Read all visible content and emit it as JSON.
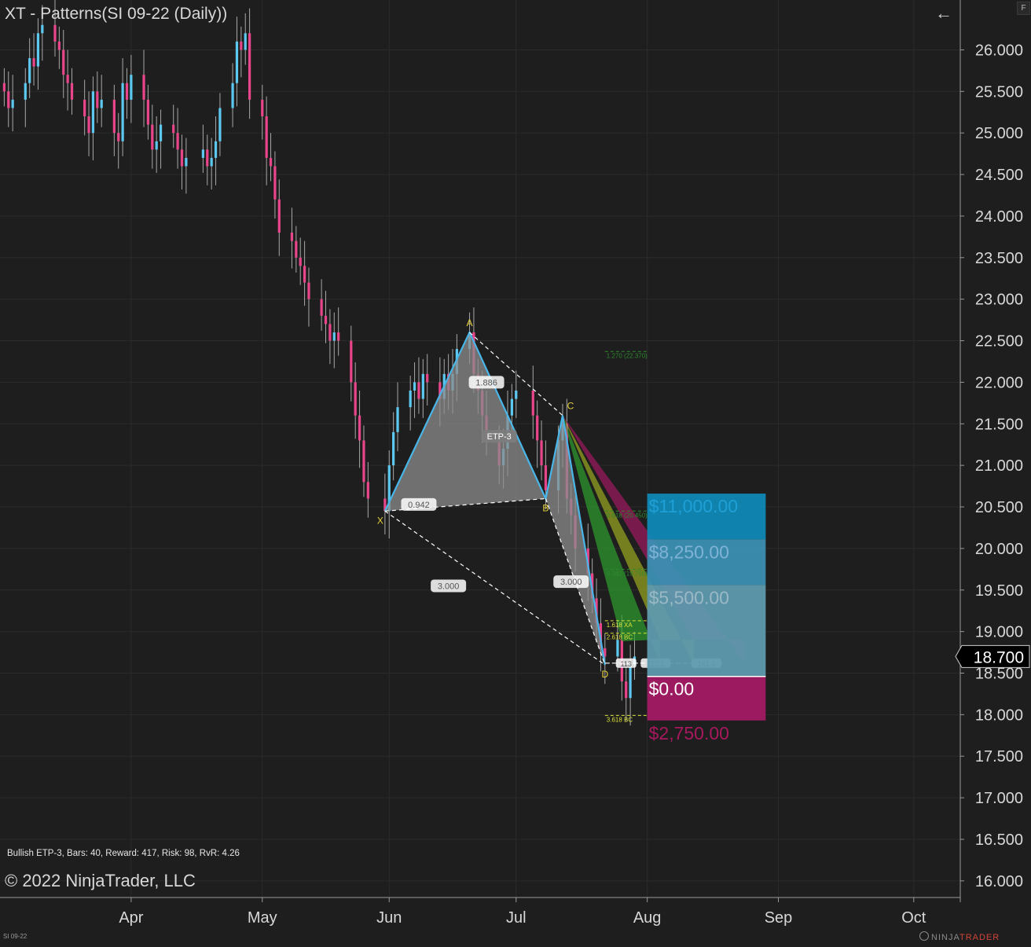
{
  "window": {
    "title": "XT - Patterns(SI 09-22 (Daily))",
    "f_badge": "F",
    "instrument_small": "SI 09-22",
    "copyright": "© 2022 NinjaTrader, LLC",
    "brand_main": "NINJA",
    "brand_accent": "TRADER",
    "status_line": "Bullish ETP-3, Bars: 40, Reward: 417, Risk: 98, RvR: 4.26"
  },
  "colors": {
    "background": "#1e1e1e",
    "up_candle": "#5cc8f0",
    "down_candle": "#e8458a",
    "pattern_line": "#49b6ea",
    "pattern_fill": "#8c8c8c",
    "target_blue": "#0f89b6",
    "stop_magenta": "#9c1a5f",
    "label_yellow": "#e9d33a",
    "fib_green": "#2e8a2e"
  },
  "chart_data": {
    "type": "candlestick",
    "instrument": "SI 09-22",
    "timeframe": "Daily",
    "y_axis": {
      "ticks": [
        16.0,
        16.5,
        17.0,
        17.5,
        18.0,
        18.5,
        19.0,
        19.5,
        20.0,
        20.5,
        21.0,
        21.5,
        22.0,
        22.5,
        23.0,
        23.5,
        24.0,
        24.5,
        25.0,
        25.5,
        26.0
      ],
      "tick_labels": [
        "16.000",
        "16.500",
        "17.000",
        "17.500",
        "18.000",
        "18.500",
        "19.000",
        "19.500",
        "20.000",
        "20.500",
        "21.000",
        "21.500",
        "22.000",
        "22.500",
        "23.000",
        "23.500",
        "24.000",
        "24.500",
        "25.000",
        "25.500",
        "26.000"
      ],
      "range": [
        15.8,
        26.6
      ]
    },
    "x_axis": {
      "tick_labels": [
        "Apr",
        "May",
        "Jun",
        "Jul",
        "Aug",
        "Sep",
        "Oct"
      ],
      "tick_dates": [
        "2022-04-01",
        "2022-05-02",
        "2022-06-01",
        "2022-07-01",
        "2022-08-01",
        "2022-09-01",
        "2022-10-03"
      ],
      "range": [
        "2022-03-01",
        "2022-10-14"
      ]
    },
    "grid": true,
    "last_price": 18.7,
    "last_price_label": "18.700",
    "closes": [
      [
        "2022-03-02",
        25.5
      ],
      [
        "2022-03-03",
        25.3
      ],
      [
        "2022-03-04",
        25.4
      ],
      [
        "2022-03-07",
        25.6
      ],
      [
        "2022-03-08",
        25.9
      ],
      [
        "2022-03-09",
        25.8
      ],
      [
        "2022-03-10",
        26.2
      ],
      [
        "2022-03-11",
        26.3
      ],
      [
        "2022-03-14",
        26.1
      ],
      [
        "2022-03-15",
        26.0
      ],
      [
        "2022-03-16",
        25.7
      ],
      [
        "2022-03-17",
        25.6
      ],
      [
        "2022-03-18",
        25.4
      ],
      [
        "2022-03-21",
        25.2
      ],
      [
        "2022-03-22",
        25.0
      ],
      [
        "2022-03-23",
        25.5
      ],
      [
        "2022-03-24",
        25.3
      ],
      [
        "2022-03-25",
        25.4
      ],
      [
        "2022-03-28",
        25.0
      ],
      [
        "2022-03-29",
        24.9
      ],
      [
        "2022-03-30",
        25.6
      ],
      [
        "2022-03-31",
        25.4
      ],
      [
        "2022-04-01",
        25.7
      ],
      [
        "2022-04-04",
        25.4
      ],
      [
        "2022-04-05",
        25.1
      ],
      [
        "2022-04-06",
        24.8
      ],
      [
        "2022-04-07",
        24.9
      ],
      [
        "2022-04-08",
        25.1
      ],
      [
        "2022-04-11",
        25.0
      ],
      [
        "2022-04-12",
        24.8
      ],
      [
        "2022-04-13",
        24.6
      ],
      [
        "2022-04-14",
        24.7
      ],
      [
        "2022-04-18",
        24.8
      ],
      [
        "2022-04-19",
        24.6
      ],
      [
        "2022-04-20",
        24.7
      ],
      [
        "2022-04-21",
        24.9
      ],
      [
        "2022-04-22",
        25.3
      ],
      [
        "2022-04-25",
        25.6
      ],
      [
        "2022-04-26",
        26.1
      ],
      [
        "2022-04-27",
        26.0
      ],
      [
        "2022-04-28",
        26.2
      ],
      [
        "2022-04-29",
        25.4
      ],
      [
        "2022-05-02",
        25.2
      ],
      [
        "2022-05-03",
        24.7
      ],
      [
        "2022-05-04",
        24.6
      ],
      [
        "2022-05-05",
        24.2
      ],
      [
        "2022-05-06",
        23.8
      ],
      [
        "2022-05-09",
        23.7
      ],
      [
        "2022-05-10",
        23.5
      ],
      [
        "2022-05-11",
        23.4
      ],
      [
        "2022-05-12",
        23.2
      ],
      [
        "2022-05-13",
        23.0
      ],
      [
        "2022-05-16",
        22.8
      ],
      [
        "2022-05-17",
        22.7
      ],
      [
        "2022-05-18",
        22.5
      ],
      [
        "2022-05-19",
        22.6
      ],
      [
        "2022-05-20",
        22.5
      ],
      [
        "2022-05-23",
        22.0
      ],
      [
        "2022-05-24",
        21.6
      ],
      [
        "2022-05-25",
        21.3
      ],
      [
        "2022-05-26",
        20.8
      ],
      [
        "2022-05-27",
        20.6
      ],
      [
        "2022-05-31",
        20.45
      ],
      [
        "2022-06-01",
        21.0
      ],
      [
        "2022-06-02",
        21.4
      ],
      [
        "2022-06-03",
        21.7
      ],
      [
        "2022-06-06",
        21.9
      ],
      [
        "2022-06-07",
        22.0
      ],
      [
        "2022-06-08",
        21.8
      ],
      [
        "2022-06-09",
        22.1
      ],
      [
        "2022-06-10",
        22.0
      ],
      [
        "2022-06-13",
        21.8
      ],
      [
        "2022-06-14",
        22.1
      ],
      [
        "2022-06-15",
        21.9
      ],
      [
        "2022-06-16",
        22.1
      ],
      [
        "2022-06-17",
        22.4
      ],
      [
        "2022-06-20",
        22.6
      ],
      [
        "2022-06-21",
        22.1
      ],
      [
        "2022-06-22",
        21.9
      ],
      [
        "2022-06-23",
        21.6
      ],
      [
        "2022-06-24",
        21.3
      ],
      [
        "2022-06-27",
        21.0
      ],
      [
        "2022-06-28",
        21.2
      ],
      [
        "2022-06-29",
        21.6
      ],
      [
        "2022-06-30",
        21.8
      ],
      [
        "2022-07-01",
        21.9
      ],
      [
        "2022-07-05",
        21.6
      ],
      [
        "2022-07-06",
        21.3
      ],
      [
        "2022-07-07",
        21.0
      ],
      [
        "2022-07-08",
        20.7
      ],
      [
        "2022-07-11",
        21.3
      ],
      [
        "2022-07-12",
        21.5
      ],
      [
        "2022-07-13",
        20.6
      ],
      [
        "2022-07-14",
        20.4
      ],
      [
        "2022-07-15",
        20.0
      ],
      [
        "2022-07-18",
        19.7
      ],
      [
        "2022-07-19",
        19.4
      ],
      [
        "2022-07-20",
        19.1
      ],
      [
        "2022-07-21",
        18.8
      ],
      [
        "2022-07-22",
        18.7
      ],
      [
        "2022-07-25",
        18.9
      ],
      [
        "2022-07-26",
        18.4
      ],
      [
        "2022-07-27",
        18.2
      ],
      [
        "2022-07-28",
        18.6
      ],
      [
        "2022-07-29",
        18.7
      ]
    ],
    "pattern": {
      "name": "ETP-3",
      "direction": "Bullish",
      "points": [
        {
          "label": "X",
          "date": "2022-05-31",
          "price": 20.45
        },
        {
          "label": "A",
          "date": "2022-06-20",
          "price": 22.6
        },
        {
          "label": "B",
          "date": "2022-07-08",
          "price": 20.6
        },
        {
          "label": "C",
          "date": "2022-07-12",
          "price": 21.6
        },
        {
          "label": "D",
          "date": "2022-07-22",
          "price": 18.6
        }
      ],
      "ratio_labels": [
        {
          "text": "0.942",
          "date": "2022-06-08",
          "price": 20.53
        },
        {
          "text": "1.886",
          "date": "2022-06-24",
          "price": 22.0
        },
        {
          "text": "3.000",
          "date": "2022-06-15",
          "price": 19.55
        },
        {
          "text": "3.000",
          "date": "2022-07-14",
          "price": 19.6
        },
        {
          "text": "ETP-3",
          "date": "2022-06-27",
          "price": 21.35
        }
      ],
      "fib_levels": [
        {
          "label": "1.270 (22.370)",
          "price": 22.37
        },
        {
          "label": "0.618 (20.450)",
          "price": 20.45
        },
        {
          "label": "0.382 (19.750)",
          "price": 19.75
        },
        {
          "label": "1.618 XA",
          "price": 19.13
        },
        {
          "label": "2.618 BC",
          "price": 18.98
        },
        {
          "label": "3.618 BC",
          "price": 17.99
        }
      ],
      "projection_labels": [
        {
          "text": "113",
          "date": "2022-07-27",
          "price": 18.62
        },
        {
          "text": "127.2",
          "date": "2022-08-03",
          "price": 18.62
        },
        {
          "text": "141.4",
          "date": "2022-08-15",
          "price": 18.62
        }
      ]
    },
    "risk_reward": {
      "entry_price": 18.46,
      "stop_price": 17.93,
      "targets": [
        {
          "label": "$11,000.00",
          "price": 20.66
        },
        {
          "label": "$8,250.00",
          "price": 20.11
        },
        {
          "label": "$5,500.00",
          "price": 19.56
        }
      ],
      "entry_label": "$0.00",
      "stop_label": "$2,750.00"
    }
  }
}
